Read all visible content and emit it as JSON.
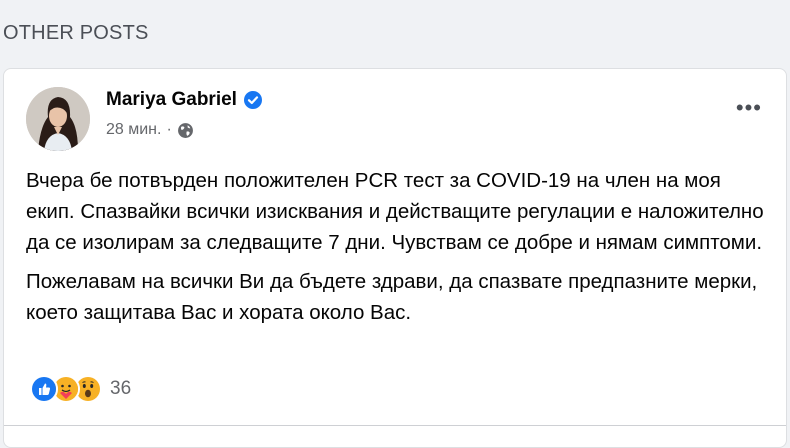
{
  "section": {
    "title": "OTHER POSTS"
  },
  "post": {
    "author": "Mariya Gabriel",
    "verified": true,
    "time": "28 мин.",
    "separator": "·",
    "privacy_icon": "globe-icon",
    "more_label": "•••",
    "paragraphs": [
      "Вчера бе потвърден положителен PCR тест за COVID-19 на член на моя екип. Спазвайки всички изисквания и действащите регулации е наложително да се изолирам за следващите 7 дни. Чувствам се добре и нямам симптоми.",
      "Пожелавам на всички Ви да бъдете здрави, да спазвате предпазните мерки, което защитава Вас и хората около Вас."
    ],
    "reactions": {
      "icons": [
        "like-icon",
        "care-icon",
        "wow-icon"
      ],
      "count": "36"
    }
  },
  "colors": {
    "brand_blue": "#1877f2",
    "secondary_text": "#65676b",
    "background": "#f0f2f5"
  }
}
